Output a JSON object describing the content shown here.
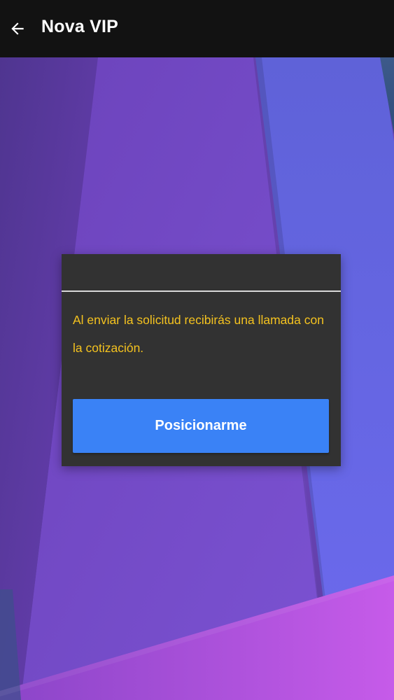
{
  "toolbar": {
    "title": "Nova VIP",
    "back_icon": "arrow-left-icon"
  },
  "dialog": {
    "message": "Al enviar la solicitud recibirás una llamada con la cotización.",
    "button_label": "Posicionarme"
  },
  "colors": {
    "toolbar_bg": "#121212",
    "dialog_bg": "#323232",
    "message_text": "#f4c21f",
    "button_bg": "#3a82f6",
    "button_text": "#ffffff",
    "background_purple": "#6e45bf",
    "background_pink": "#b55be6"
  }
}
